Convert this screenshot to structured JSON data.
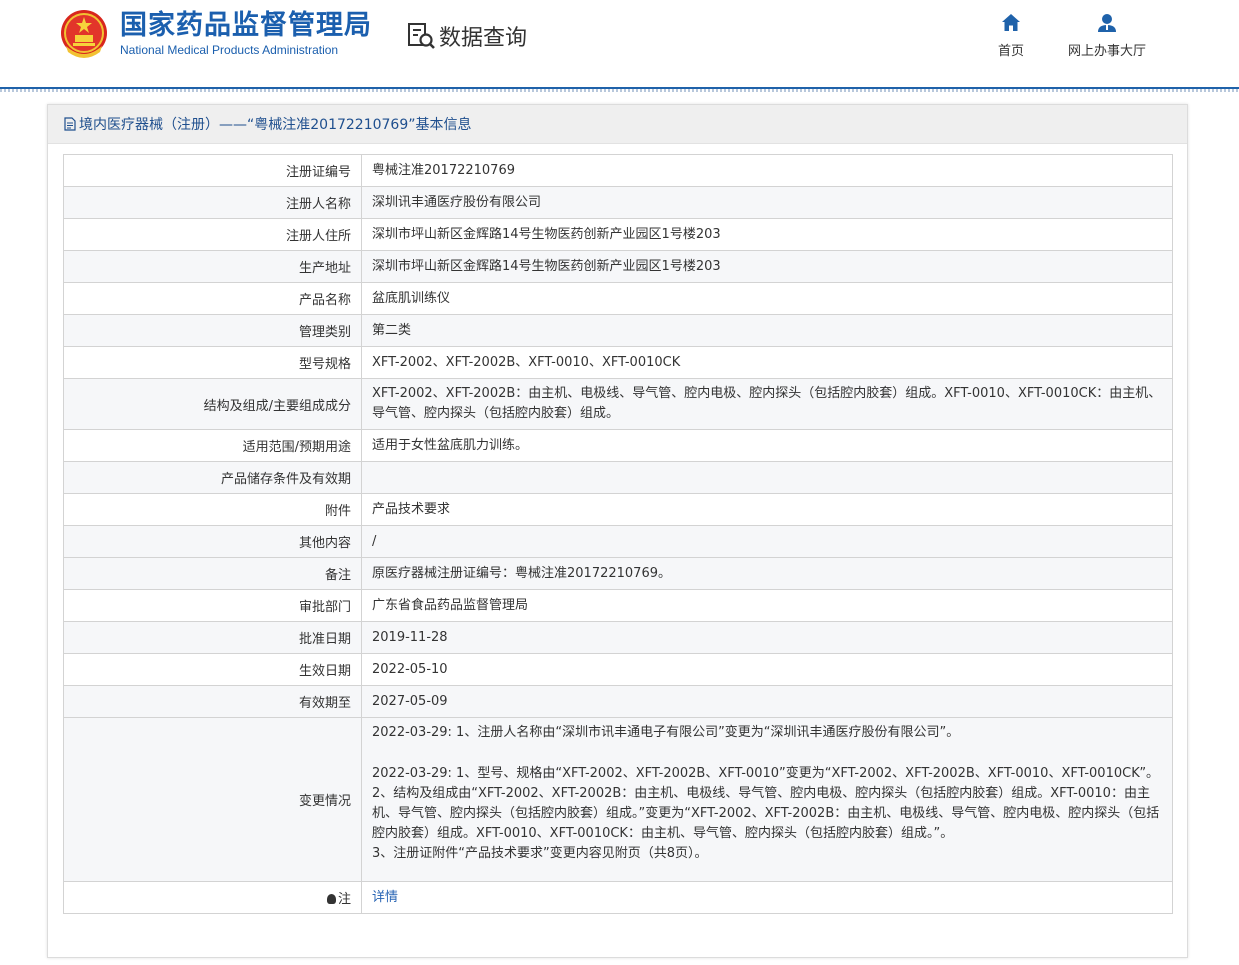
{
  "header": {
    "agency_cn": "国家药品监督管理局",
    "agency_en": "National Medical Products Administration",
    "query_label": "数据查询",
    "nav": [
      {
        "label": "首页",
        "icon": "home-icon"
      },
      {
        "label": "网上办事大厅",
        "icon": "user-icon"
      }
    ]
  },
  "panel": {
    "title": "境内医疗器械（注册）——“粤械注准20172210769”基本信息"
  },
  "fields": [
    {
      "label": "注册证编号",
      "value": "粤械注准20172210769"
    },
    {
      "label": "注册人名称",
      "value": "深圳讯丰通医疗股份有限公司"
    },
    {
      "label": "注册人住所",
      "value": "深圳市坪山新区金辉路14号生物医药创新产业园区1号楼203"
    },
    {
      "label": "生产地址",
      "value": "深圳市坪山新区金辉路14号生物医药创新产业园区1号楼203"
    },
    {
      "label": "产品名称",
      "value": "盆底肌训练仪"
    },
    {
      "label": "管理类别",
      "value": "第二类"
    },
    {
      "label": "型号规格",
      "value": "XFT-2002、XFT-2002B、XFT-0010、XFT-0010CK"
    },
    {
      "label": "结构及组成/主要组成成分",
      "value": "XFT-2002、XFT-2002B：由主机、电极线、导气管、腔内电极、腔内探头（包括腔内胶套）组成。XFT-0010、XFT-0010CK：由主机、导气管、腔内探头（包括腔内胶套）组成。"
    },
    {
      "label": "适用范围/预期用途",
      "value": "适用于女性盆底肌力训练。"
    },
    {
      "label": "产品储存条件及有效期",
      "value": ""
    },
    {
      "label": "附件",
      "value": "产品技术要求"
    },
    {
      "label": "其他内容",
      "value": "/"
    },
    {
      "label": "备注",
      "value": "原医疗器械注册证编号：粤械注准20172210769。"
    },
    {
      "label": "审批部门",
      "value": "广东省食品药品监督管理局"
    },
    {
      "label": "批准日期",
      "value": "2019-11-28"
    },
    {
      "label": "生效日期",
      "value": "2022-05-10"
    },
    {
      "label": "有效期至",
      "value": "2027-05-09"
    }
  ],
  "changes": {
    "label": "变更情况",
    "entry1": "2022-03-29: 1、注册人名称由“深圳市讯丰通电子有限公司”变更为“深圳讯丰通医疗股份有限公司”。",
    "entry2_line1": "2022-03-29: 1、型号、规格由“XFT-2002、XFT-2002B、XFT-0010”变更为“XFT-2002、XFT-2002B、XFT-0010、XFT-0010CK”。",
    "entry2_line2": "2、结构及组成由“XFT-2002、XFT-2002B：由主机、电极线、导气管、腔内电极、腔内探头（包括腔内胶套）组成。XFT-0010：由主机、导气管、腔内探头（包括腔内胶套）组成。”变更为“XFT-2002、XFT-2002B：由主机、电极线、导气管、腔内电极、腔内探头（包括腔内胶套）组成。XFT-0010、XFT-0010CK：由主机、导气管、腔内探头（包括腔内胶套）组成。”。",
    "entry2_line3": "3、注册证附件“产品技术要求”变更内容见附页（共8页）。"
  },
  "note": {
    "label": "注",
    "link": "详情"
  },
  "colors": {
    "brand_blue": "#1b5fae",
    "link_blue": "#2864b4",
    "alt_row": "#f6f7f9"
  }
}
